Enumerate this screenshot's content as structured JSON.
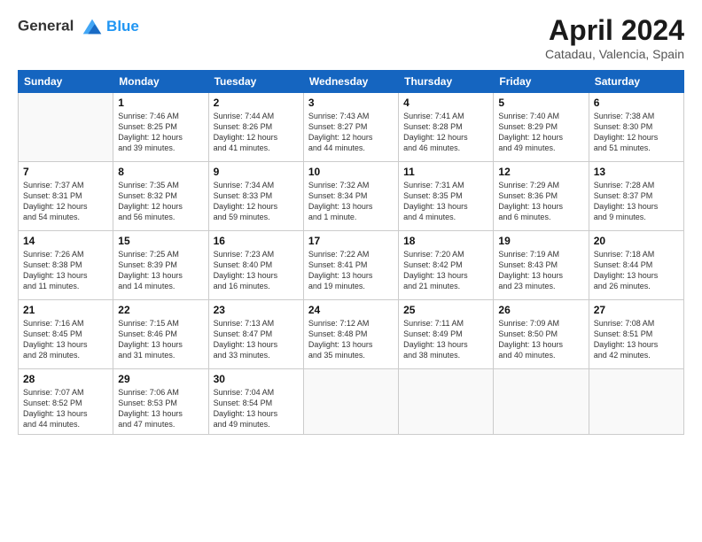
{
  "logo": {
    "line1": "General",
    "line2": "Blue"
  },
  "title": "April 2024",
  "subtitle": "Catadau, Valencia, Spain",
  "days_of_week": [
    "Sunday",
    "Monday",
    "Tuesday",
    "Wednesday",
    "Thursday",
    "Friday",
    "Saturday"
  ],
  "weeks": [
    [
      {
        "day": "",
        "info": ""
      },
      {
        "day": "1",
        "info": "Sunrise: 7:46 AM\nSunset: 8:25 PM\nDaylight: 12 hours\nand 39 minutes."
      },
      {
        "day": "2",
        "info": "Sunrise: 7:44 AM\nSunset: 8:26 PM\nDaylight: 12 hours\nand 41 minutes."
      },
      {
        "day": "3",
        "info": "Sunrise: 7:43 AM\nSunset: 8:27 PM\nDaylight: 12 hours\nand 44 minutes."
      },
      {
        "day": "4",
        "info": "Sunrise: 7:41 AM\nSunset: 8:28 PM\nDaylight: 12 hours\nand 46 minutes."
      },
      {
        "day": "5",
        "info": "Sunrise: 7:40 AM\nSunset: 8:29 PM\nDaylight: 12 hours\nand 49 minutes."
      },
      {
        "day": "6",
        "info": "Sunrise: 7:38 AM\nSunset: 8:30 PM\nDaylight: 12 hours\nand 51 minutes."
      }
    ],
    [
      {
        "day": "7",
        "info": "Sunrise: 7:37 AM\nSunset: 8:31 PM\nDaylight: 12 hours\nand 54 minutes."
      },
      {
        "day": "8",
        "info": "Sunrise: 7:35 AM\nSunset: 8:32 PM\nDaylight: 12 hours\nand 56 minutes."
      },
      {
        "day": "9",
        "info": "Sunrise: 7:34 AM\nSunset: 8:33 PM\nDaylight: 12 hours\nand 59 minutes."
      },
      {
        "day": "10",
        "info": "Sunrise: 7:32 AM\nSunset: 8:34 PM\nDaylight: 13 hours\nand 1 minute."
      },
      {
        "day": "11",
        "info": "Sunrise: 7:31 AM\nSunset: 8:35 PM\nDaylight: 13 hours\nand 4 minutes."
      },
      {
        "day": "12",
        "info": "Sunrise: 7:29 AM\nSunset: 8:36 PM\nDaylight: 13 hours\nand 6 minutes."
      },
      {
        "day": "13",
        "info": "Sunrise: 7:28 AM\nSunset: 8:37 PM\nDaylight: 13 hours\nand 9 minutes."
      }
    ],
    [
      {
        "day": "14",
        "info": "Sunrise: 7:26 AM\nSunset: 8:38 PM\nDaylight: 13 hours\nand 11 minutes."
      },
      {
        "day": "15",
        "info": "Sunrise: 7:25 AM\nSunset: 8:39 PM\nDaylight: 13 hours\nand 14 minutes."
      },
      {
        "day": "16",
        "info": "Sunrise: 7:23 AM\nSunset: 8:40 PM\nDaylight: 13 hours\nand 16 minutes."
      },
      {
        "day": "17",
        "info": "Sunrise: 7:22 AM\nSunset: 8:41 PM\nDaylight: 13 hours\nand 19 minutes."
      },
      {
        "day": "18",
        "info": "Sunrise: 7:20 AM\nSunset: 8:42 PM\nDaylight: 13 hours\nand 21 minutes."
      },
      {
        "day": "19",
        "info": "Sunrise: 7:19 AM\nSunset: 8:43 PM\nDaylight: 13 hours\nand 23 minutes."
      },
      {
        "day": "20",
        "info": "Sunrise: 7:18 AM\nSunset: 8:44 PM\nDaylight: 13 hours\nand 26 minutes."
      }
    ],
    [
      {
        "day": "21",
        "info": "Sunrise: 7:16 AM\nSunset: 8:45 PM\nDaylight: 13 hours\nand 28 minutes."
      },
      {
        "day": "22",
        "info": "Sunrise: 7:15 AM\nSunset: 8:46 PM\nDaylight: 13 hours\nand 31 minutes."
      },
      {
        "day": "23",
        "info": "Sunrise: 7:13 AM\nSunset: 8:47 PM\nDaylight: 13 hours\nand 33 minutes."
      },
      {
        "day": "24",
        "info": "Sunrise: 7:12 AM\nSunset: 8:48 PM\nDaylight: 13 hours\nand 35 minutes."
      },
      {
        "day": "25",
        "info": "Sunrise: 7:11 AM\nSunset: 8:49 PM\nDaylight: 13 hours\nand 38 minutes."
      },
      {
        "day": "26",
        "info": "Sunrise: 7:09 AM\nSunset: 8:50 PM\nDaylight: 13 hours\nand 40 minutes."
      },
      {
        "day": "27",
        "info": "Sunrise: 7:08 AM\nSunset: 8:51 PM\nDaylight: 13 hours\nand 42 minutes."
      }
    ],
    [
      {
        "day": "28",
        "info": "Sunrise: 7:07 AM\nSunset: 8:52 PM\nDaylight: 13 hours\nand 44 minutes."
      },
      {
        "day": "29",
        "info": "Sunrise: 7:06 AM\nSunset: 8:53 PM\nDaylight: 13 hours\nand 47 minutes."
      },
      {
        "day": "30",
        "info": "Sunrise: 7:04 AM\nSunset: 8:54 PM\nDaylight: 13 hours\nand 49 minutes."
      },
      {
        "day": "",
        "info": ""
      },
      {
        "day": "",
        "info": ""
      },
      {
        "day": "",
        "info": ""
      },
      {
        "day": "",
        "info": ""
      }
    ]
  ]
}
